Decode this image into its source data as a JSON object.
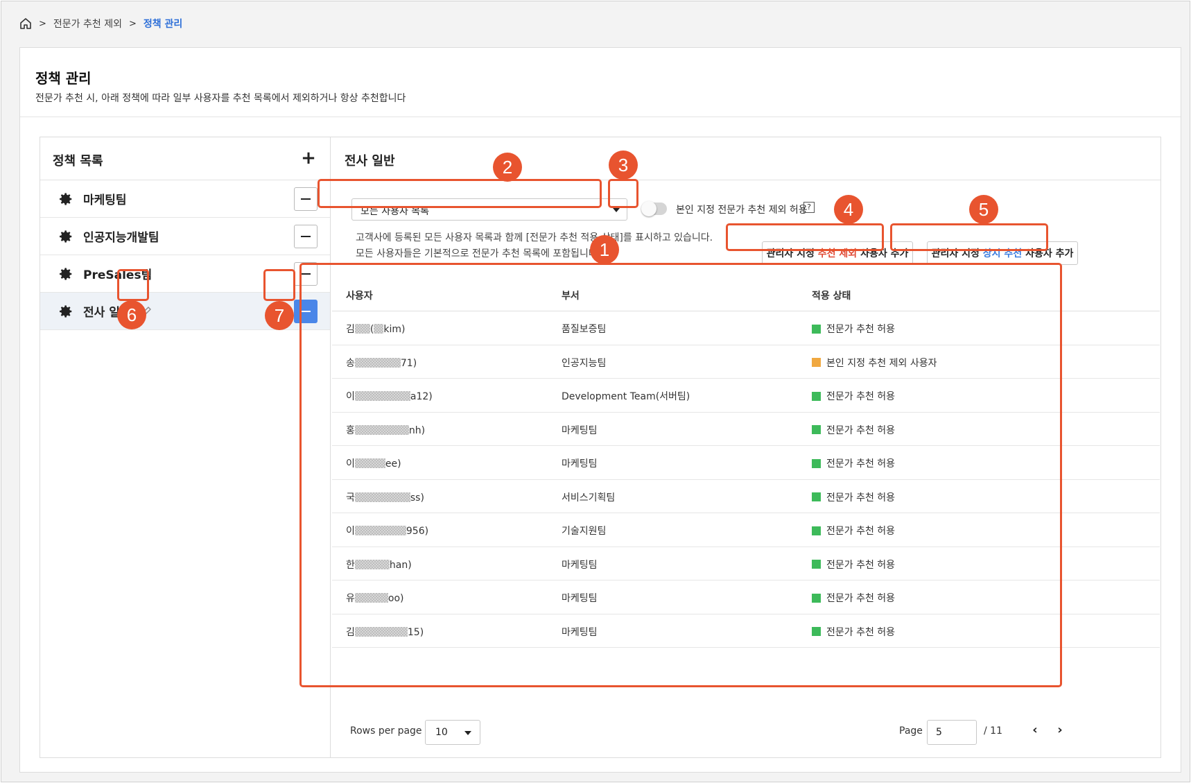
{
  "breadcrumb": {
    "parent": "전문가 추천 제외",
    "current": "정책 관리"
  },
  "header": {
    "title": "정책 관리",
    "description": "전문가 추천 시, 아래 정책에 따라 일부 사용자를 추천 목록에서 제외하거나 항상 추천합니다"
  },
  "policy_list": {
    "title": "정책 목록",
    "add_label": "+",
    "items": [
      {
        "label": "마케팅팀"
      },
      {
        "label": "인공지능개발팀"
      },
      {
        "label": "PreSales팀"
      },
      {
        "label": "전사 일반"
      }
    ]
  },
  "detail": {
    "title": "전사 일반",
    "user_filter": {
      "selected": "모든 사용자 목록"
    },
    "toggle": {
      "label": "본인 지정 전문가 추천 제외 허용",
      "checked": false,
      "help": "?"
    },
    "info_line1": "고객사에 등록된 모든 사용자 목록과 함께 [전문가 추천 적용 상태]를 표시하고 있습니다.",
    "info_line2": "모든 사용자들은 기본적으로 전문가 추천 목록에 포함됩니다.",
    "btn_exclude": {
      "prefix": "관리자 지정 ",
      "highlight": "추천 제외",
      "suffix": " 사용자 추가"
    },
    "btn_always": {
      "prefix": "관리자 지정 ",
      "highlight": "상시 추천",
      "suffix": " 사용자 추가"
    }
  },
  "table": {
    "columns": [
      "사용자",
      "부서",
      "적용 상태"
    ],
    "rows": [
      {
        "user_start": "김",
        "user_end": "(",
        "user_end2": "kim)",
        "dept": "품질보증팀",
        "status": "전문가 추천 허용",
        "color": "#3dba5a"
      },
      {
        "user_start": "송",
        "user_end": "71)",
        "dept": "인공지능팀",
        "status": "본인 지정 추천 제외 사용자",
        "color": "#f0a840"
      },
      {
        "user_start": "이",
        "user_end": "a12)",
        "dept": "Development Team(서버팀)",
        "status": "전문가 추천 허용",
        "color": "#3dba5a"
      },
      {
        "user_start": "홍",
        "user_end": "nh)",
        "dept": "마케팅팀",
        "status": "전문가 추천 허용",
        "color": "#3dba5a"
      },
      {
        "user_start": "이",
        "user_end": "ee)",
        "dept": "마케팅팀",
        "status": "전문가 추천 허용",
        "color": "#3dba5a"
      },
      {
        "user_start": "국",
        "user_end": "ss)",
        "dept": "서비스기획팀",
        "status": "전문가 추천 허용",
        "color": "#3dba5a"
      },
      {
        "user_start": "이",
        "user_end": "956)",
        "dept": "기술지원팀",
        "status": "전문가 추천 허용",
        "color": "#3dba5a"
      },
      {
        "user_start": "한",
        "user_end": "han)",
        "dept": "마케팅팀",
        "status": "전문가 추천 허용",
        "color": "#3dba5a"
      },
      {
        "user_start": "유",
        "user_end": "oo)",
        "dept": "마케팅팀",
        "status": "전문가 추천 허용",
        "color": "#3dba5a"
      },
      {
        "user_start": "김",
        "user_end": "15)",
        "dept": "마케팅팀",
        "status": "전문가 추천 허용",
        "color": "#3dba5a"
      }
    ]
  },
  "pagination": {
    "rows_per_page_label": "Rows per page",
    "rows_per_page": "10",
    "page_label": "Page",
    "page": "5",
    "total": "/ 11",
    "prev": "‹",
    "next": "›"
  },
  "annotations": [
    "1",
    "2",
    "3",
    "4",
    "5",
    "6",
    "7"
  ],
  "colors": {
    "accent": "#e8542f",
    "primary": "#4a86e8",
    "link": "#2d6fd8"
  }
}
